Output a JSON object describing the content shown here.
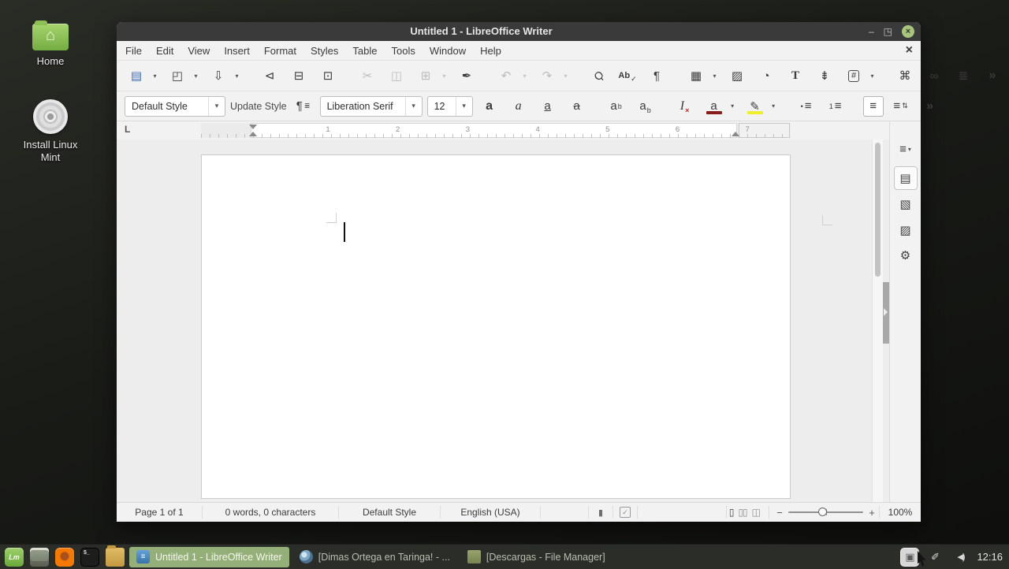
{
  "desktop": {
    "icons": [
      {
        "name": "home",
        "label": "Home",
        "glyph": "⌂"
      },
      {
        "name": "install-linux-mint",
        "label": "Install Linux Mint"
      }
    ]
  },
  "window": {
    "title": "Untitled 1 - LibreOffice Writer",
    "controls": {
      "minimize": "–",
      "restore": "◳",
      "close": "×"
    },
    "menu": [
      "File",
      "Edit",
      "View",
      "Insert",
      "Format",
      "Styles",
      "Table",
      "Tools",
      "Window",
      "Help"
    ],
    "menu_close": "×",
    "toolbar_main": [
      {
        "name": "new-document-button",
        "base": "▤",
        "cls": "c-new",
        "drop": true
      },
      {
        "name": "open-button",
        "base": "◰",
        "drop": true
      },
      {
        "name": "save-button",
        "base": "⇩",
        "drop": true
      },
      {
        "sep": true
      },
      {
        "name": "export-pdf-button",
        "base": "⊲"
      },
      {
        "name": "print-button",
        "base": "⊟"
      },
      {
        "name": "print-preview-button",
        "base": "⊡"
      },
      {
        "sep": true
      },
      {
        "name": "cut-button",
        "base": "✂",
        "disabled": true
      },
      {
        "name": "copy-button",
        "base": "◫",
        "disabled": true
      },
      {
        "name": "paste-button",
        "base": "⊞",
        "disabled": true,
        "drop": true
      },
      {
        "name": "clone-formatting-button",
        "base": "✒"
      },
      {
        "sep": true
      },
      {
        "name": "undo-button",
        "base": "↶",
        "disabled": true,
        "drop": true
      },
      {
        "name": "redo-button",
        "base": "↷",
        "disabled": true,
        "drop": true
      },
      {
        "sep": true
      },
      {
        "name": "find-replace-button",
        "base": "Ϙ",
        "cls": "rot"
      },
      {
        "name": "spelling-button",
        "base": "Ab",
        "cls": "sm",
        "mod": "✓",
        "modtype": "sub"
      },
      {
        "name": "formatting-marks-button",
        "base": "¶"
      },
      {
        "sep": true
      },
      {
        "name": "insert-table-button",
        "base": "▦",
        "drop": true
      },
      {
        "name": "insert-image-button",
        "base": "▨"
      },
      {
        "name": "insert-chart-button",
        "base": "◔"
      },
      {
        "name": "insert-textbox-button",
        "base": "T",
        "cls": "serif"
      },
      {
        "name": "insert-pagebreak-button",
        "base": "⇟"
      },
      {
        "name": "insert-field-button",
        "base": "#",
        "boxed": true,
        "drop": true
      },
      {
        "sep": true
      },
      {
        "name": "special-character-button",
        "base": "⌘"
      },
      {
        "name": "insert-hyperlink-button",
        "base": "∞"
      },
      {
        "name": "insert-footnote-button",
        "base": "≣"
      },
      {
        "name": "toolbar-overflow-button",
        "base": "»",
        "cls": "b"
      }
    ],
    "format": {
      "style_value": "Default Style",
      "update_label": "Update Style",
      "para_icon_base": "¶",
      "para_icon_mod": "≣",
      "font_value": "Liberation Serif",
      "size_value": "12"
    },
    "format_buttons": [
      {
        "name": "bold-button",
        "base": "a",
        "cls": "b"
      },
      {
        "name": "italic-button",
        "base": "a",
        "cls": "i"
      },
      {
        "name": "underline-button",
        "base": "a",
        "cls": "u"
      },
      {
        "name": "strikethrough-button",
        "base": "a",
        "cls": "st"
      },
      {
        "sep": true
      },
      {
        "name": "superscript-button",
        "base": "a",
        "mod": "b",
        "modtype": "sup"
      },
      {
        "name": "subscript-button",
        "base": "a",
        "mod": "b",
        "modtype": "sub"
      },
      {
        "sep": true
      },
      {
        "name": "clear-formatting-button",
        "base": "I",
        "cls": "i",
        "mod": "×",
        "modtype": "sub red"
      },
      {
        "name": "font-color-button",
        "base": "a",
        "bar": "#8b1c1c",
        "drop": true
      },
      {
        "name": "highlight-color-button",
        "base": "✎",
        "bar": "#f0f02a",
        "drop": true
      },
      {
        "sep": true
      },
      {
        "name": "bullet-list-button",
        "base": "≡",
        "mod": "•",
        "modtype": "pre"
      },
      {
        "name": "numbered-list-button",
        "base": "≡",
        "mod": "1",
        "modtype": "pre"
      },
      {
        "sep": true
      },
      {
        "name": "align-left-button",
        "base": "≡",
        "active": true
      },
      {
        "name": "line-spacing-button",
        "base": "≡",
        "mod": "⇅",
        "modtype": "post"
      },
      {
        "name": "format-overflow-button",
        "base": "»",
        "cls": "b"
      }
    ],
    "ruler": {
      "tab_selector": "L",
      "numbers": [
        "1",
        "2",
        "3",
        "4",
        "5",
        "6",
        "7"
      ]
    },
    "sidebar": [
      {
        "name": "sidebar-menu-button",
        "base": "≡",
        "mod": "▾",
        "modtype": "post"
      },
      {
        "name": "sidebar-tab-properties",
        "base": "▤",
        "active": true
      },
      {
        "name": "sidebar-tab-page",
        "base": "▧"
      },
      {
        "name": "sidebar-tab-gallery",
        "base": "▨"
      },
      {
        "name": "sidebar-tab-settings",
        "base": "⚙"
      }
    ],
    "statusbar": {
      "page": "Page 1 of 1",
      "words": "0 words, 0 characters",
      "style": "Default Style",
      "language": "English (USA)",
      "selection_icon": "▮",
      "modified_icon": "✓",
      "view_single": "▯",
      "view_multi": "▯▯",
      "view_book": "◫",
      "zoom_out": "−",
      "zoom_in": "+",
      "zoom_level": "100%"
    }
  },
  "taskbar": {
    "launchers": [
      {
        "name": "mint-menu-button",
        "cls": "la-mint",
        "text": "Lm"
      },
      {
        "name": "show-desktop-button",
        "cls": "la-desk",
        "text": ""
      },
      {
        "name": "firefox-launcher",
        "cls": "la-ff",
        "text": ""
      },
      {
        "name": "terminal-launcher",
        "cls": "la-term",
        "text": "$_"
      },
      {
        "name": "files-launcher",
        "cls": "la-files",
        "text": ""
      }
    ],
    "tasks": [
      {
        "name": "task-writer",
        "icon": "writer",
        "glyph": "≡",
        "label": "Untitled 1 - LibreOffice Writer",
        "active": true
      },
      {
        "name": "task-browser",
        "icon": "globe",
        "glyph": "",
        "label": "[Dimas Ortega en Taringa! - ..."
      },
      {
        "name": "task-filemanager",
        "icon": "folder",
        "glyph": "",
        "label": "[Descargas - File Manager]"
      }
    ],
    "tray": [
      {
        "name": "tray-notification-icon",
        "cls": "tray-hi",
        "glyph": "▣"
      },
      {
        "name": "tray-network-icon",
        "cls": "",
        "glyph": "✐"
      },
      {
        "name": "tray-volume-icon",
        "cls": "tray-vol",
        "glyph": "◀)"
      }
    ],
    "clock": "12:16"
  }
}
